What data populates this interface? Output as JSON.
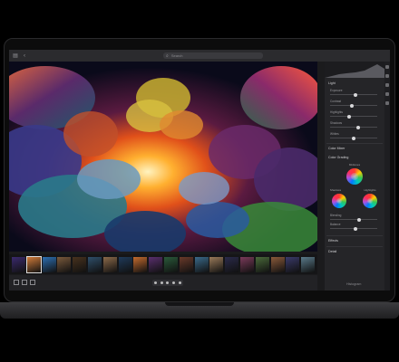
{
  "app": {
    "search_placeholder": "Search",
    "toolbar_icons": [
      "sidebar-icon",
      "back-icon",
      "forward-icon"
    ]
  },
  "panel": {
    "sections": {
      "light": "Light",
      "effects_label": "Color Mixer",
      "grading": "Color Grading",
      "midtones": "Midtones",
      "shadows": "Shadows",
      "highlights": "Highlights",
      "blending": "Blending",
      "balance": "Balance",
      "effects": "Effects",
      "detail": "Detail"
    },
    "sliders": [
      {
        "label": "Exposure",
        "value": 0.55
      },
      {
        "label": "Contrast",
        "value": 0.45
      },
      {
        "label": "Highlights",
        "value": 0.4
      },
      {
        "label": "Shadows",
        "value": 0.6
      },
      {
        "label": "Whites",
        "value": 0.5
      }
    ],
    "footer_label": "Histogram"
  },
  "filmstrip": {
    "count": 20,
    "colors": [
      "#3b2a6e",
      "#d07b3a",
      "#2d6fb2",
      "#7a5a3c",
      "#48321e",
      "#2f4f6a",
      "#8c6a4a",
      "#1f3a5a",
      "#c46b2e",
      "#5a2f6e",
      "#2a5a3a",
      "#6a3a2a",
      "#3a6a8a",
      "#9a7a5a",
      "#2a2a4a",
      "#7a3a5a",
      "#4a6a3a",
      "#8a5a3a",
      "#3a3a6a",
      "#5a7a8a"
    ]
  },
  "colors": {
    "accent": "#0a84ff",
    "chrome": "#252528"
  }
}
